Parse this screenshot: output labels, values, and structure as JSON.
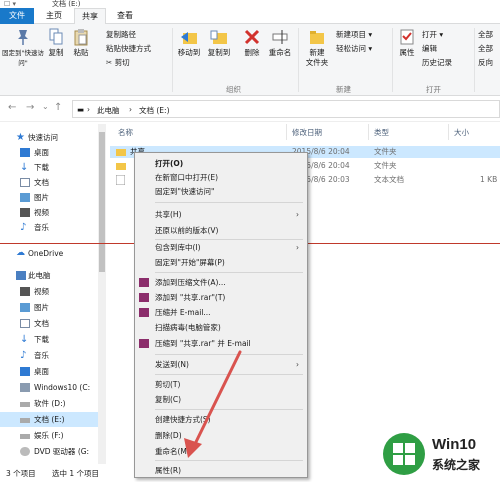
{
  "window": {
    "title": "文档 (E:)",
    "quick_access": "☐ ▾"
  },
  "tabs": {
    "file": "文件",
    "home": "主页",
    "share": "共享",
    "view": "查看"
  },
  "ribbon": {
    "pin_quick": "固定到\"快速访问\"",
    "copy": "复制",
    "paste": "粘贴",
    "copy_path": "复制路径",
    "paste_shortcut": "粘贴快捷方式",
    "cut": "剪切",
    "move_to": "移动到",
    "copy_to": "复制到",
    "delete": "删除",
    "rename": "重命名",
    "new_folder": "新建\n文件夹",
    "new_item": "新建项目",
    "easy_access": "轻松访问",
    "properties": "属性",
    "open": "打开",
    "edit": "编辑",
    "history": "历史记录",
    "select_all": "全部",
    "select_none": "全部",
    "invert": "反向",
    "group_organize": "组织",
    "group_new": "新建",
    "group_open": "打开"
  },
  "address": {
    "back": "←",
    "forward": "→",
    "recent": "⌄",
    "up": "↑",
    "this_pc": "此电脑",
    "sep": "›",
    "drive": "文档 (E:)",
    "sep2": "›"
  },
  "columns": {
    "name": "名称",
    "modified": "修改日期",
    "type": "类型",
    "size": "大小"
  },
  "files": [
    {
      "name": "共享",
      "modified": "2015/8/6 20:04",
      "type": "文件夹",
      "size": ""
    },
    {
      "name": "",
      "modified": "2015/8/6 20:04",
      "type": "文件夹",
      "size": ""
    },
    {
      "name": "",
      "modified": "2015/8/6 20:03",
      "type": "文本文档",
      "size": "1 KB"
    }
  ],
  "sidebar": {
    "quick_access": "快速访问",
    "desktop": "桌面",
    "downloads": "下载",
    "documents": "文档",
    "pictures": "图片",
    "videos": "视频",
    "music": "音乐",
    "onedrive": "OneDrive",
    "this_pc": "此电脑",
    "pc_videos": "视频",
    "pc_pictures": "图片",
    "pc_documents": "文档",
    "pc_downloads": "下载",
    "pc_music": "音乐",
    "pc_desktop": "桌面",
    "drive_c": "Windows10 (C:",
    "drive_d": "软件 (D:)",
    "drive_e": "文档 (E:)",
    "drive_f": "娱乐 (F:)",
    "drive_g": "DVD 驱动器 (G:"
  },
  "status": {
    "count": "3 个项目",
    "selected": "选中 1 个项目"
  },
  "context_menu": {
    "open": "打开(O)",
    "open_new_window": "在新窗口中打开(E)",
    "pin_quick": "固定到\"快速访问\"",
    "share": "共享(H)",
    "restore": "还原以前的版本(V)",
    "include_library": "包含到库中(I)",
    "pin_start": "固定到\"开始\"屏幕(P)",
    "add_archive": "添加到压缩文件(A)...",
    "add_rar": "添加到 \"共享.rar\"(T)",
    "compress_email": "压缩并 E-mail...",
    "scan": "扫描病毒(电脑管家)",
    "compress_rar_email": "压缩到 \"共享.rar\" 并 E-mail",
    "send_to": "发送到(N)",
    "cut": "剪切(T)",
    "copy": "复制(C)",
    "create_shortcut": "创建快捷方式(S)",
    "delete": "删除(D)",
    "rename": "重命名(M)",
    "properties": "属性(R)",
    "submenu_arrow": "›"
  },
  "watermark": {
    "brand": "Win10",
    "subtitle": "系统之家"
  },
  "colors": {
    "accent": "#1979ca",
    "selection": "#cce8ff",
    "arrow": "#d9534f",
    "redline": "#c0392b"
  }
}
